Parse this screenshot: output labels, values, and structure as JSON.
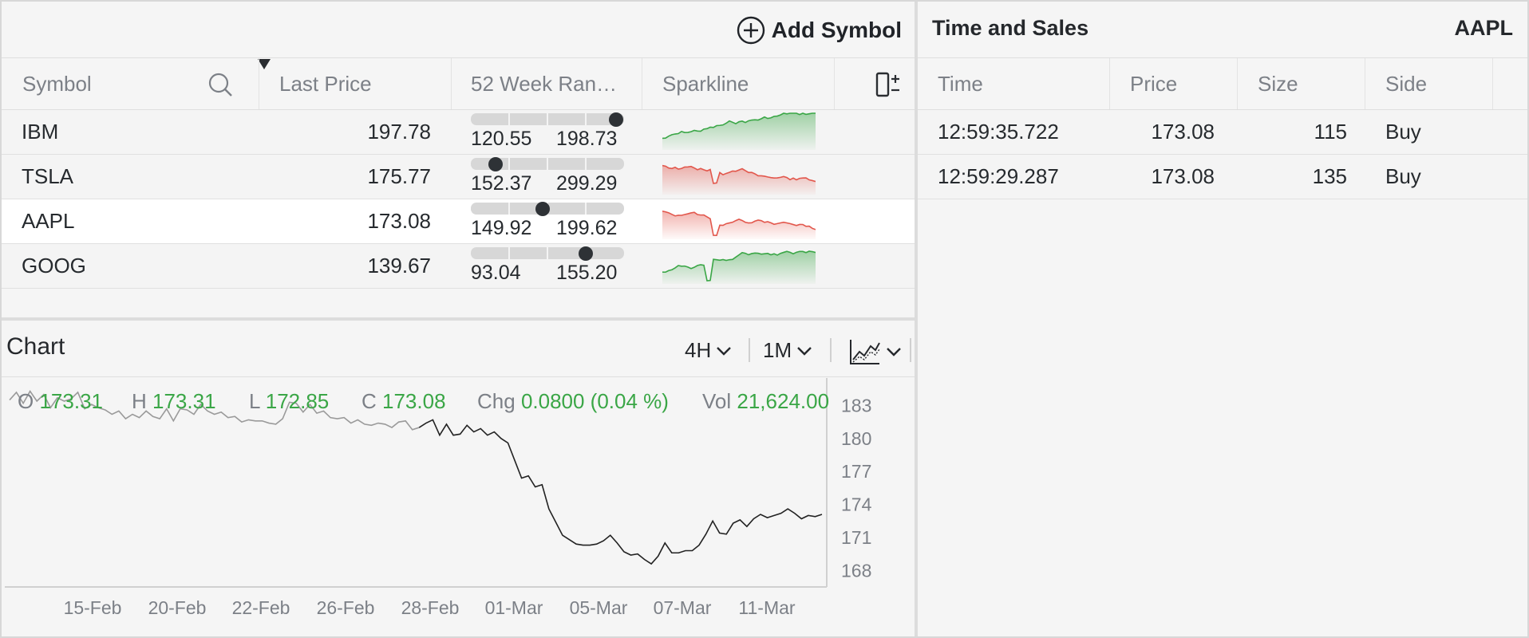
{
  "watchlist": {
    "add_symbol_label": "Add Symbol",
    "columns": {
      "symbol": "Symbol",
      "last_price": "Last Price",
      "range": "52 Week Ran…",
      "sparkline": "Sparkline"
    },
    "rows": [
      {
        "symbol": "IBM",
        "last": "197.78",
        "low": "120.55",
        "high": "198.73",
        "range_pos": 0.95,
        "trend": "up"
      },
      {
        "symbol": "TSLA",
        "last": "175.77",
        "low": "152.37",
        "high": "299.29",
        "range_pos": 0.16,
        "trend": "down"
      },
      {
        "symbol": "AAPL",
        "last": "173.08",
        "low": "149.92",
        "high": "199.62",
        "range_pos": 0.47,
        "trend": "down",
        "selected": true
      },
      {
        "symbol": "GOOG",
        "last": "139.67",
        "low": "93.04",
        "high": "155.20",
        "range_pos": 0.75,
        "trend": "up"
      }
    ]
  },
  "chart": {
    "title": "Chart",
    "interval": "4H",
    "period": "1M",
    "ohlc": {
      "o_label": "O",
      "o": "173.31",
      "h_label": "H",
      "h": "173.31",
      "l_label": "L",
      "l": "172.85",
      "c_label": "C",
      "c": "173.08",
      "chg_label": "Chg",
      "chg": "0.0800 (0.04 %)",
      "vol_label": "Vol",
      "vol": "21,624.00"
    },
    "colors": {
      "up": "#3aa646",
      "down": "#e2574c",
      "line": "#222222"
    }
  },
  "chart_data": {
    "type": "line",
    "x": [
      "15-Feb",
      "20-Feb",
      "22-Feb",
      "26-Feb",
      "28-Feb",
      "01-Mar",
      "05-Mar",
      "07-Mar",
      "11-Mar"
    ],
    "yticks": [
      "183",
      "180",
      "177",
      "174",
      "171",
      "168"
    ],
    "ylim": [
      166.5,
      185.5
    ],
    "series": [
      {
        "values": [
          183.5,
          184.2,
          183.2,
          184.3,
          183.4,
          184.0,
          182.8,
          183.7,
          183.4,
          183.6,
          184.2,
          182.7,
          183.1,
          182.8,
          182.6,
          182.2,
          182.5,
          181.8,
          182.2,
          181.9,
          182.5,
          182.0,
          181.8,
          182.7,
          181.6,
          182.7,
          182.6,
          182.2,
          183.1,
          182.5,
          182.2,
          182.4,
          181.9,
          182.0,
          181.5,
          181.7,
          181.6,
          181.6,
          181.4,
          181.3,
          181.8,
          183.3,
          183.2,
          182.4,
          183.1,
          182.3,
          182.5,
          181.9,
          181.8,
          181.9,
          181.4,
          181.7,
          181.3,
          181.2,
          181.4,
          181.3,
          181.0,
          181.5,
          181.6,
          180.8,
          181.0,
          181.4,
          181.7,
          180.3,
          181.3,
          180.3,
          180.4,
          181.2,
          180.6,
          180.9,
          180.3,
          180.6,
          180.0,
          179.6,
          178.0,
          176.4,
          176.6,
          175.6,
          175.8,
          173.6,
          172.4,
          171.2,
          170.8,
          170.4,
          170.3,
          170.3,
          170.4,
          170.7,
          171.2,
          170.5,
          169.7,
          169.4,
          169.5,
          169.0,
          168.6,
          169.3,
          170.5,
          169.6,
          169.6,
          169.8,
          169.8,
          170.3,
          171.3,
          172.5,
          171.4,
          171.3,
          172.3,
          172.6,
          172.0,
          172.7,
          173.1,
          172.8,
          173.0,
          173.2,
          173.6,
          173.2,
          172.7,
          173.0,
          172.9,
          173.1
        ]
      }
    ]
  },
  "time_sales": {
    "title": "Time and Sales",
    "symbol": "AAPL",
    "columns": {
      "time": "Time",
      "price": "Price",
      "size": "Size",
      "side": "Side"
    },
    "rows": [
      {
        "time": "12:59:35.722",
        "price": "173.08",
        "size": "115",
        "side": "Buy"
      },
      {
        "time": "12:59:29.287",
        "price": "173.08",
        "size": "135",
        "side": "Buy"
      }
    ]
  }
}
